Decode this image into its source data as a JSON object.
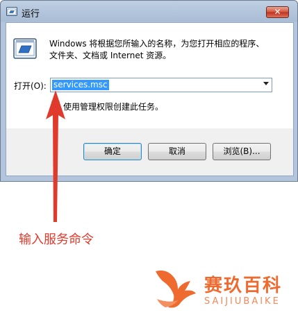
{
  "window": {
    "title": "运行"
  },
  "dialog": {
    "description_line1": "Windows 将根据您所输入的名称，为您打开相应的程序、",
    "description_line2": "文件夹、文档或 Internet 资源。",
    "open_label": "打开(O):",
    "command_value": "services.msc",
    "admin_note": "使用管理权限创建此任务。",
    "ok_label": "确定",
    "cancel_label": "取消",
    "browse_label": "浏览(B)..."
  },
  "annotation": {
    "text": "输入服务命令",
    "color": "#e03a2c"
  },
  "watermark": {
    "brand": "赛玖百科",
    "subtitle": "SAIJIUBAIKE",
    "color": "#ef6a2f"
  },
  "icons": {
    "run": "run-program-icon",
    "shield": "uac-shield-icon",
    "close": "close-icon",
    "dropdown": "chevron-down-icon"
  }
}
